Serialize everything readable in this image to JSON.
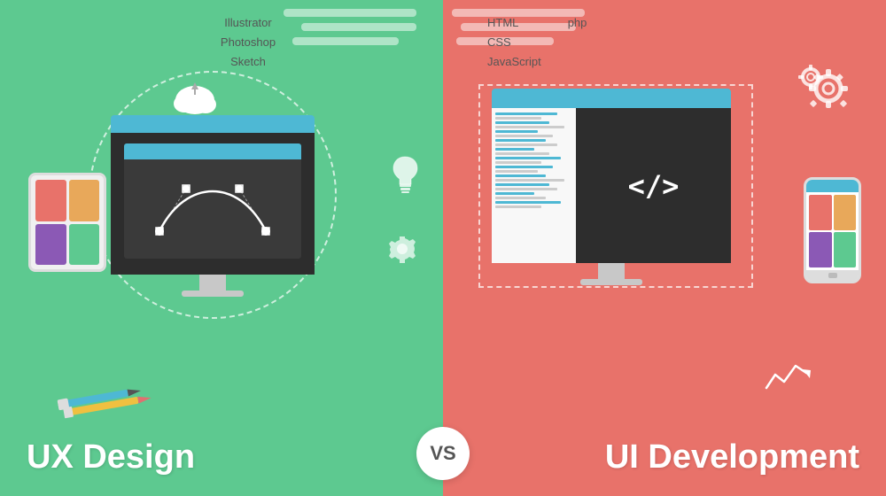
{
  "left": {
    "bg_color": "#5dc990",
    "tools": [
      "Illustrator",
      "Photoshop",
      "Sketch"
    ],
    "title": "UX Design"
  },
  "right": {
    "bg_color": "#e8736b",
    "tools": [
      "HTML",
      "php",
      "CSS",
      "JavaScript"
    ],
    "title": "UI Development"
  },
  "vs_label": "VS",
  "tablet_colors": [
    "#e8726a",
    "#e8a55a",
    "#8b59b5",
    "#5dc990"
  ],
  "phone_colors": [
    "#e8726a",
    "#e8a55a",
    "#8b59b5",
    "#5dc990"
  ],
  "accent_color": "#4eb8d4"
}
